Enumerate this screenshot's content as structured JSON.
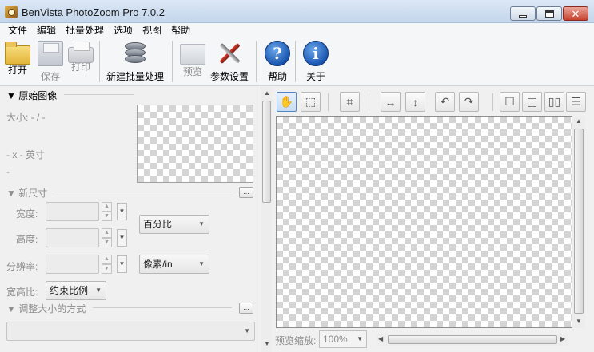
{
  "window": {
    "title": "BenVista PhotoZoom Pro 7.0.2"
  },
  "menu": [
    "文件",
    "编辑",
    "批量处理",
    "选项",
    "视图",
    "帮助"
  ],
  "toolbar": {
    "open": "打开",
    "save": "保存",
    "print": "打印",
    "batch": "新建批量处理",
    "preview": "预览",
    "settings": "参数设置",
    "help": "帮助",
    "about": "关于"
  },
  "icons": {
    "help_glyph": "?",
    "about_glyph": "i",
    "more_glyph": "..."
  },
  "original": {
    "header": "▼ 原始图像",
    "size": "大小: - / -",
    "dims": "- x - 英寸",
    "dash": "-"
  },
  "new_size": {
    "header": "▼ 新尺寸",
    "width_label": "宽度:",
    "height_label": "高度:",
    "resolution_label": "分辨率:",
    "unit_percent": "百分比",
    "unit_res": "像素/in",
    "aspect_label": "宽高比:",
    "aspect_value": "约束比例"
  },
  "resize_method": {
    "header": "▼ 调整大小的方式"
  },
  "preview_bar": {
    "zoom_label": "预览缩放:",
    "zoom_value": "100%"
  }
}
